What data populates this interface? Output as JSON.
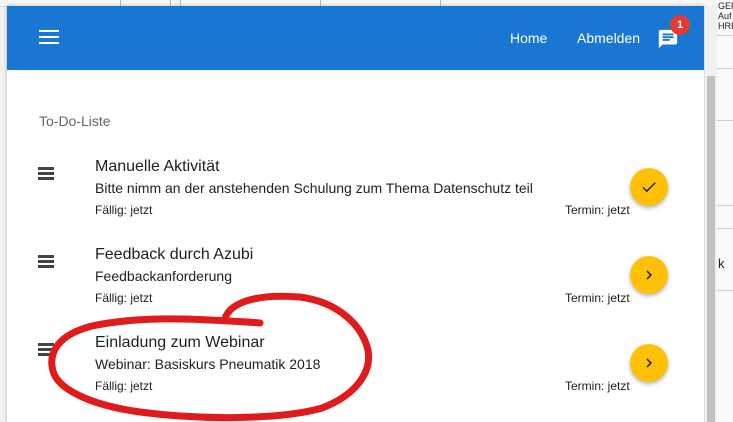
{
  "header": {
    "home_label": "Home",
    "logout_label": "Abmelden",
    "notification_count": "1",
    "accent_color": "#1976d2",
    "badge_color": "#e53935"
  },
  "section": {
    "title": "To-Do-Liste"
  },
  "todo_items": [
    {
      "title": "Manuelle Aktivität",
      "subtitle": "Bitte nimm an der anstehenden Schulung zum Thema Datenschutz teil",
      "due": "Fällig: jetzt",
      "termin": "Termin: jetzt",
      "action_icon": "check-icon"
    },
    {
      "title": "Feedback durch Azubi",
      "subtitle": "Feedbackanforderung",
      "due": "Fällig: jetzt",
      "termin": "Termin: jetzt",
      "action_icon": "chevron-right-icon"
    },
    {
      "title": "Einladung zum Webinar",
      "subtitle": "Webinar: Basiskurs Pneumatik 2018",
      "due": "Fällig: jetzt",
      "termin": "Termin: jetzt",
      "action_icon": "chevron-right-icon"
    }
  ],
  "background_window": {
    "snippets": [
      "GER",
      "Auf",
      "HRE",
      "k"
    ]
  },
  "fab_color": "#ffc107",
  "annotation_color": "#e01b1b"
}
